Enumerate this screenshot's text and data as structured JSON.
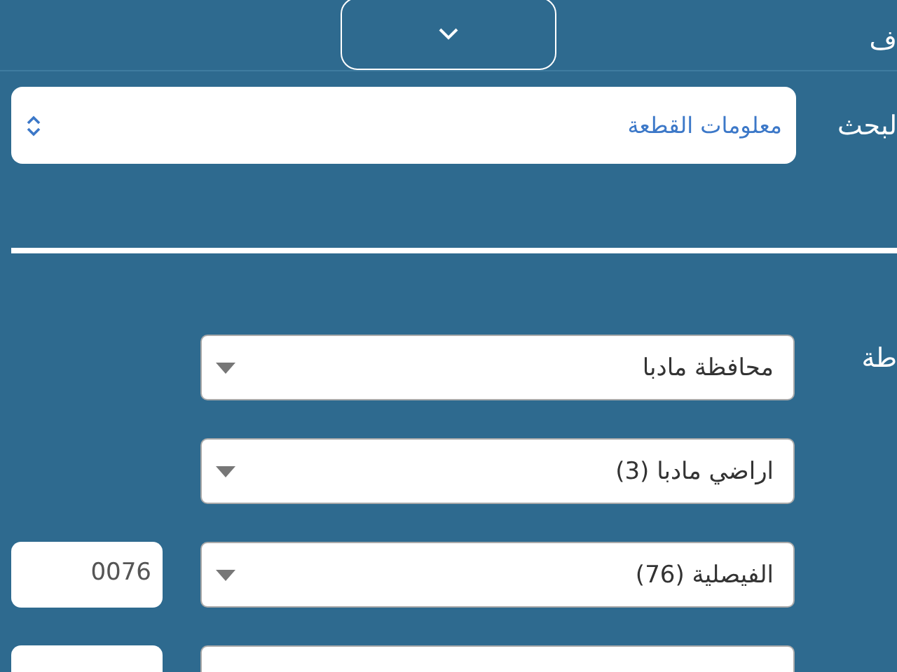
{
  "header": {
    "label": "ف",
    "toggle": {
      "expanded": false
    }
  },
  "search": {
    "label": "لبحث",
    "value": "معلومات القطعة"
  },
  "location": {
    "label": "طة",
    "rows": [
      {
        "select": "محافظة مادبا"
      },
      {
        "select": "اراضي مادبا (3)"
      },
      {
        "select": "الفيصلية (76)",
        "code": "0076"
      },
      {
        "kind": "partial"
      }
    ]
  }
}
